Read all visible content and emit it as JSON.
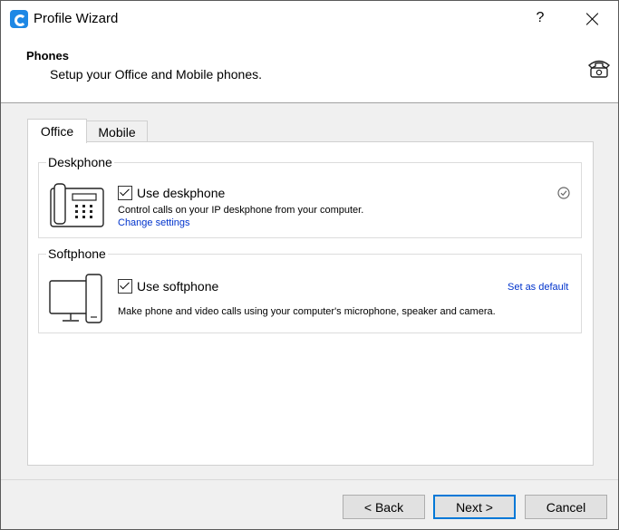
{
  "window": {
    "title": "Profile Wizard",
    "help_label": "?"
  },
  "header": {
    "title": "Phones",
    "subtitle": "Setup your Office and Mobile phones."
  },
  "tabs": [
    {
      "label": "Office"
    },
    {
      "label": "Mobile"
    }
  ],
  "deskphone": {
    "group_title": "Deskphone",
    "checkbox_label": "Use deskphone",
    "checked": true,
    "description": "Control calls on your IP deskphone from your computer.",
    "link": "Change settings"
  },
  "softphone": {
    "group_title": "Softphone",
    "checkbox_label": "Use softphone",
    "checked": true,
    "description": "Make phone and video calls using your computer's microphone, speaker and camera.",
    "link": "Set as default"
  },
  "buttons": {
    "back": "< Back",
    "next": "Next >",
    "cancel": "Cancel"
  },
  "colors": {
    "link": "#0033cc",
    "accent": "#0078d7",
    "app_icon": "#1e88e5"
  },
  "icons": {
    "app": "app-logo-icon",
    "header": "telephone-icon",
    "deskphone": "deskphone-icon",
    "softphone": "computer-phone-icon",
    "status": "check-circle-icon"
  }
}
